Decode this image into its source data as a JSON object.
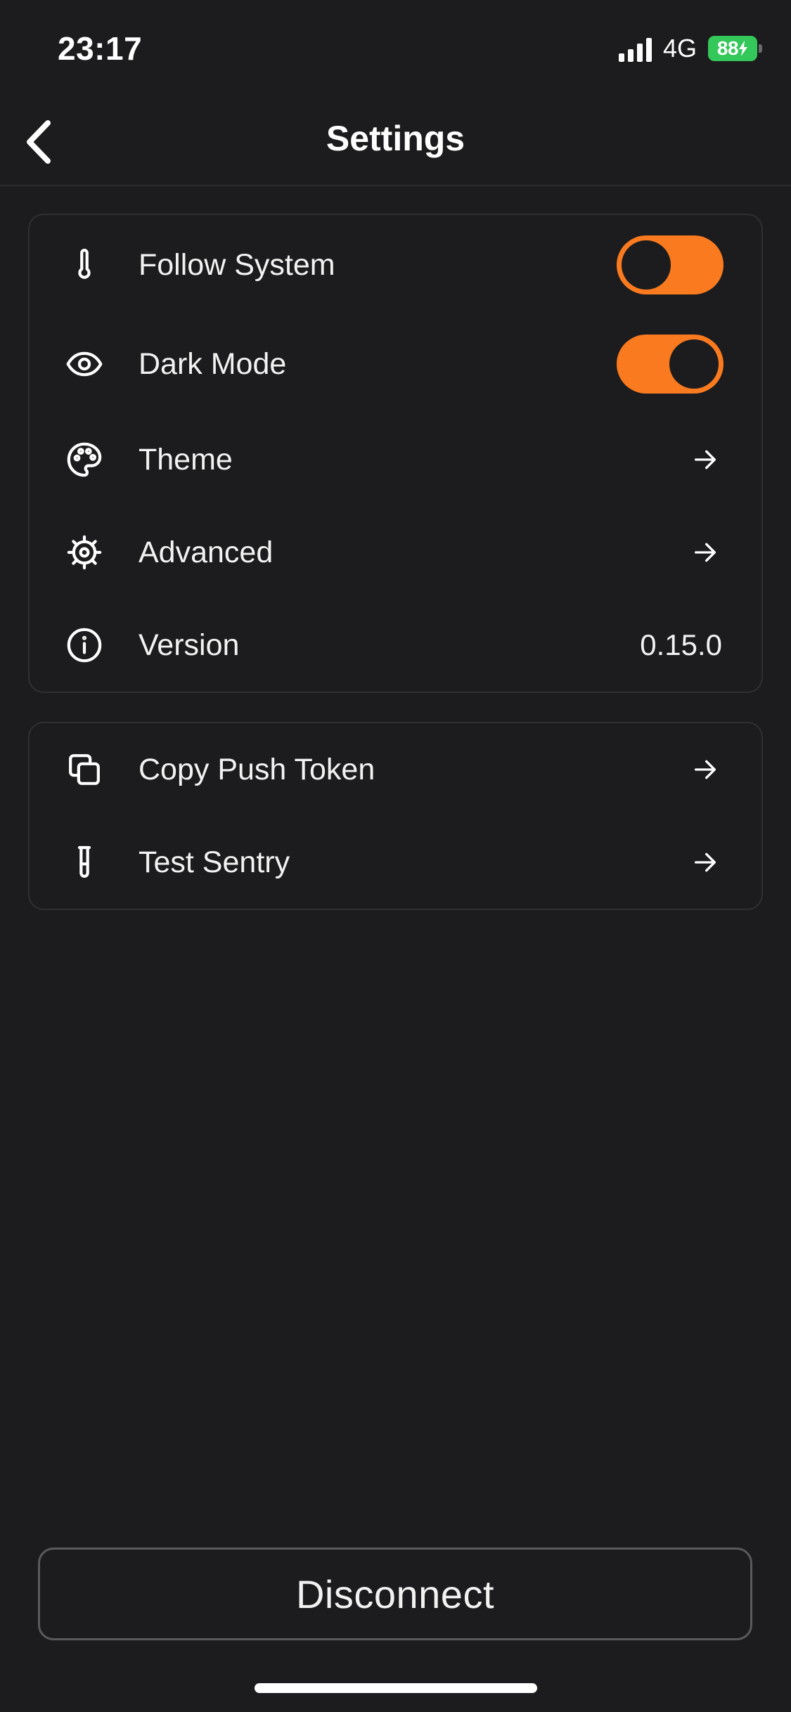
{
  "status_bar": {
    "time": "23:17",
    "network": "4G",
    "battery": "88"
  },
  "nav": {
    "title": "Settings",
    "back_icon": "chevron-left-icon"
  },
  "colors": {
    "background": "#1c1c1e",
    "accent": "#f97a1f",
    "battery": "#34c759"
  },
  "settings_group": {
    "follow_system": {
      "label": "Follow System",
      "icon": "thermometer-icon",
      "toggle_on": true,
      "toggle_knob": "left"
    },
    "dark_mode": {
      "label": "Dark Mode",
      "icon": "eye-icon",
      "toggle_on": true,
      "toggle_knob": "right"
    },
    "theme": {
      "label": "Theme",
      "icon": "palette-icon"
    },
    "advanced": {
      "label": "Advanced",
      "icon": "gear-icon"
    },
    "version": {
      "label": "Version",
      "icon": "info-icon",
      "value": "0.15.0"
    }
  },
  "developer_group": {
    "copy_push_token": {
      "label": "Copy Push Token",
      "icon": "copy-icon"
    },
    "test_sentry": {
      "label": "Test Sentry",
      "icon": "test-tube-icon"
    }
  },
  "disconnect_label": "Disconnect"
}
